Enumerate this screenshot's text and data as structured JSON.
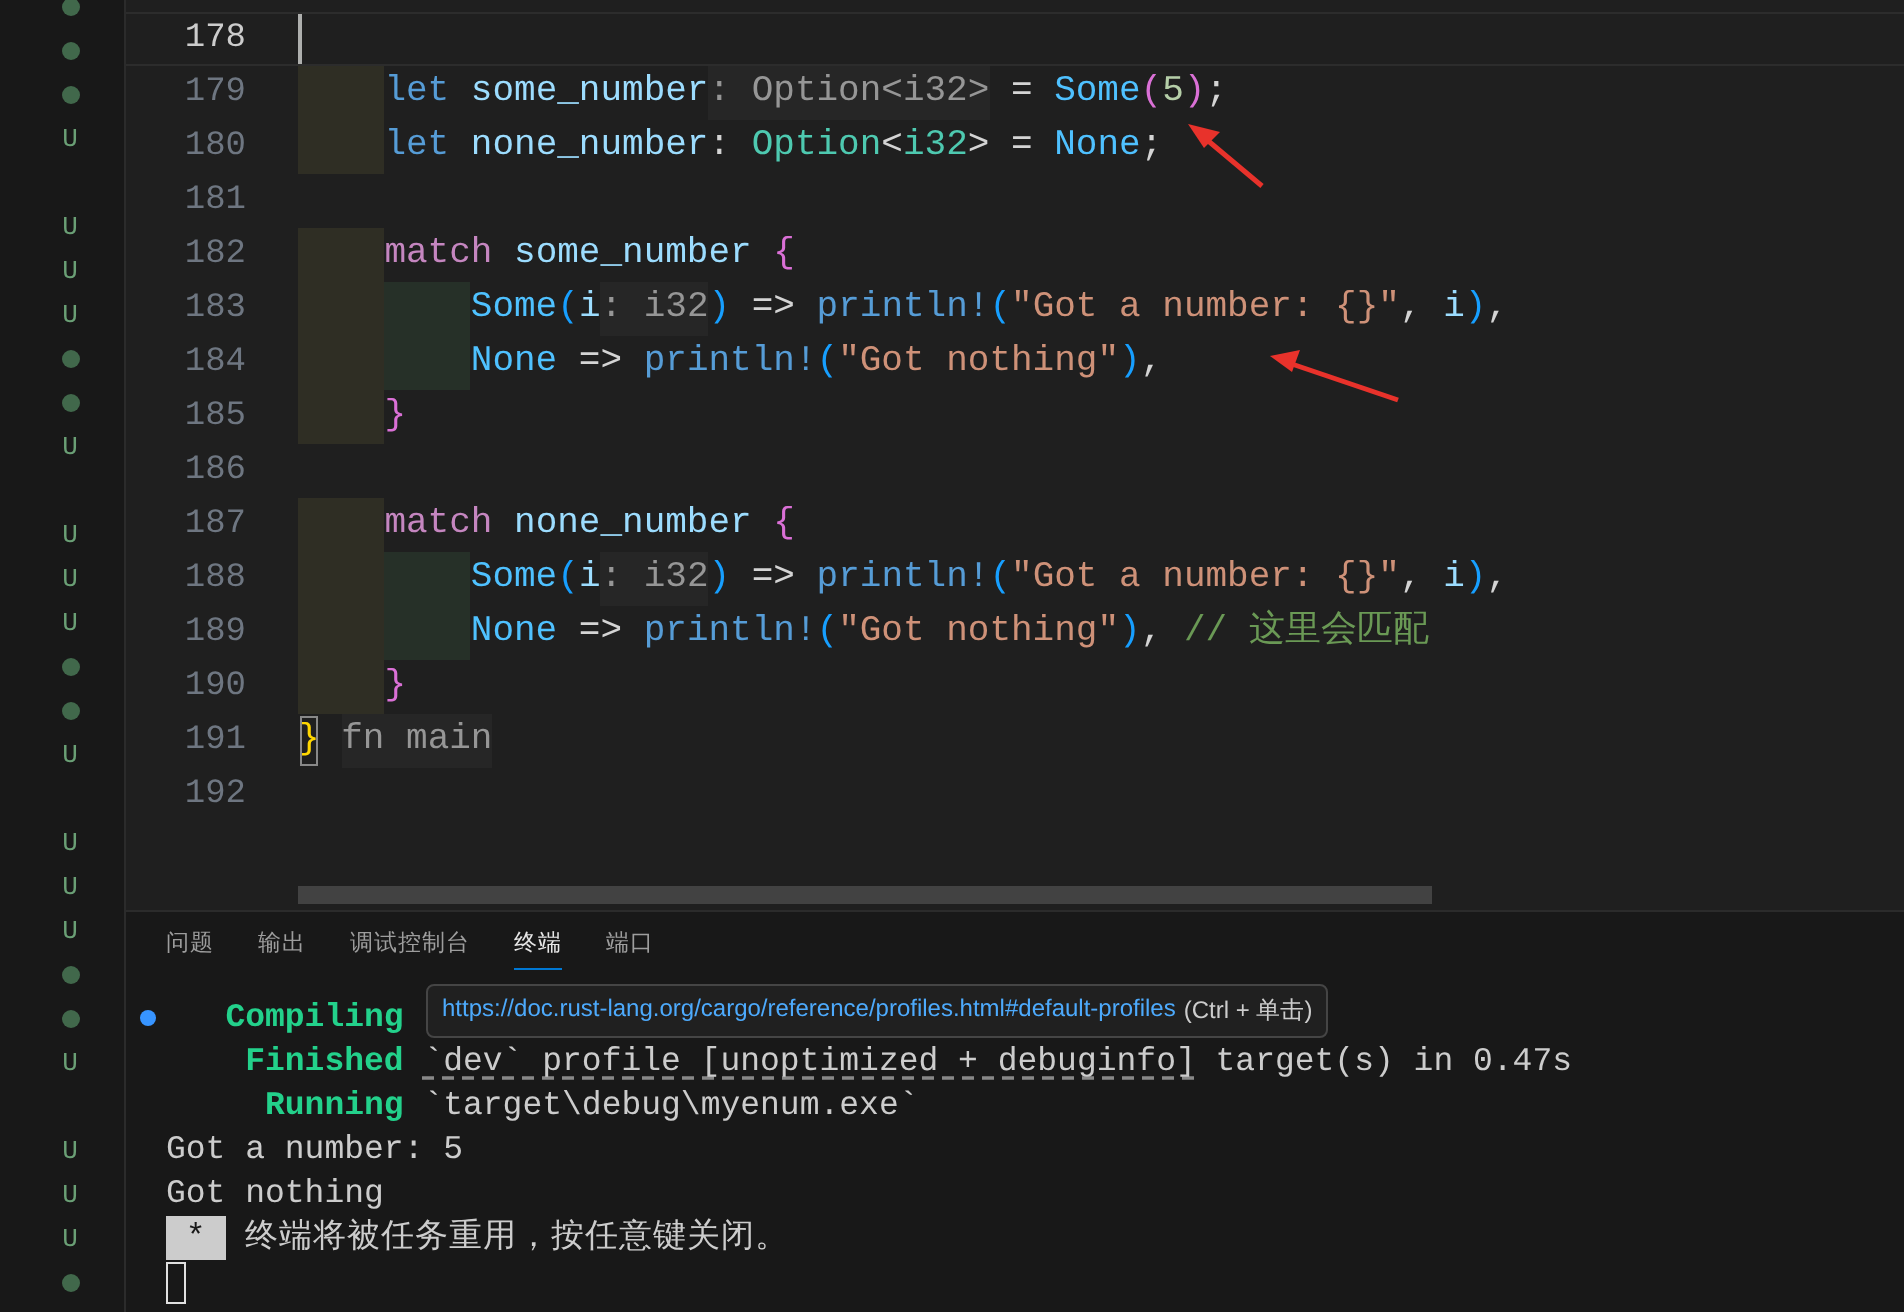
{
  "gutter_markers": [
    {
      "kind": "dot"
    },
    {
      "kind": "dot"
    },
    {
      "kind": "dot"
    },
    {
      "kind": "letter",
      "text": "U"
    },
    {
      "kind": "blank"
    },
    {
      "kind": "letter",
      "text": "U"
    },
    {
      "kind": "letter",
      "text": "U"
    },
    {
      "kind": "letter",
      "text": "U"
    },
    {
      "kind": "dot"
    },
    {
      "kind": "dot"
    },
    {
      "kind": "letter",
      "text": "U"
    },
    {
      "kind": "blank"
    },
    {
      "kind": "letter",
      "text": "U"
    },
    {
      "kind": "letter",
      "text": "U"
    },
    {
      "kind": "letter",
      "text": "U"
    },
    {
      "kind": "dot"
    },
    {
      "kind": "dot"
    },
    {
      "kind": "letter",
      "text": "U"
    },
    {
      "kind": "blank"
    },
    {
      "kind": "letter",
      "text": "U"
    },
    {
      "kind": "letter",
      "text": "U"
    },
    {
      "kind": "letter",
      "text": "U"
    },
    {
      "kind": "dot"
    },
    {
      "kind": "dot"
    },
    {
      "kind": "letter",
      "text": "U"
    },
    {
      "kind": "blank"
    },
    {
      "kind": "letter",
      "text": "U"
    },
    {
      "kind": "letter",
      "text": "U"
    },
    {
      "kind": "letter",
      "text": "U"
    },
    {
      "kind": "dot"
    }
  ],
  "editor": {
    "lines": [
      {
        "number": "178",
        "current": true
      },
      {
        "number": "179",
        "current": false,
        "tokens": [
          {
            "kind": "keyword",
            "text": "    let"
          },
          {
            "kind": "variable",
            "text": " some_number"
          },
          {
            "kind": "hint",
            "text": ": Option<i32>"
          },
          {
            "kind": "punct",
            "text": " = "
          },
          {
            "kind": "enum",
            "text": "Some"
          },
          {
            "kind": "bracket2",
            "text": "("
          },
          {
            "kind": "number",
            "text": "5"
          },
          {
            "kind": "bracket2",
            "text": ")"
          },
          {
            "kind": "punct",
            "text": ";"
          }
        ]
      },
      {
        "number": "180",
        "current": false,
        "tokens": [
          {
            "kind": "keyword",
            "text": "    let"
          },
          {
            "kind": "variable",
            "text": " none_number"
          },
          {
            "kind": "punct",
            "text": ": "
          },
          {
            "kind": "type",
            "text": "Option"
          },
          {
            "kind": "punct",
            "text": "<"
          },
          {
            "kind": "type",
            "text": "i32"
          },
          {
            "kind": "punct",
            "text": "> = "
          },
          {
            "kind": "enum",
            "text": "None"
          },
          {
            "kind": "punct",
            "text": ";"
          }
        ]
      },
      {
        "number": "181",
        "current": false
      },
      {
        "number": "182",
        "current": false,
        "tokens": [
          {
            "kind": "control",
            "text": "    match"
          },
          {
            "kind": "variable",
            "text": " some_number "
          },
          {
            "kind": "bracket2",
            "text": "{"
          }
        ]
      },
      {
        "number": "183",
        "current": false,
        "tokens": [
          {
            "kind": "enum",
            "text": "        Some"
          },
          {
            "kind": "bracket3",
            "text": "("
          },
          {
            "kind": "variable",
            "text": "i"
          },
          {
            "kind": "hint",
            "text": ": i32"
          },
          {
            "kind": "bracket3",
            "text": ")"
          },
          {
            "kind": "punct",
            "text": " => "
          },
          {
            "kind": "macro",
            "text": "println!"
          },
          {
            "kind": "bracket3",
            "text": "("
          },
          {
            "kind": "string",
            "text": "\"Got a number: {}\""
          },
          {
            "kind": "punct",
            "text": ", "
          },
          {
            "kind": "variable",
            "text": "i"
          },
          {
            "kind": "bracket3",
            "text": ")"
          },
          {
            "kind": "punct",
            "text": ","
          }
        ]
      },
      {
        "number": "184",
        "current": false,
        "tokens": [
          {
            "kind": "enum",
            "text": "        None"
          },
          {
            "kind": "punct",
            "text": " => "
          },
          {
            "kind": "macro",
            "text": "println!"
          },
          {
            "kind": "bracket3",
            "text": "("
          },
          {
            "kind": "string",
            "text": "\"Got nothing\""
          },
          {
            "kind": "bracket3",
            "text": ")"
          },
          {
            "kind": "punct",
            "text": ","
          }
        ]
      },
      {
        "number": "185",
        "current": false,
        "tokens": [
          {
            "kind": "bracket2",
            "text": "    }"
          }
        ]
      },
      {
        "number": "186",
        "current": false
      },
      {
        "number": "187",
        "current": false,
        "tokens": [
          {
            "kind": "control",
            "text": "    match"
          },
          {
            "kind": "variable",
            "text": " none_number "
          },
          {
            "kind": "bracket2",
            "text": "{"
          }
        ]
      },
      {
        "number": "188",
        "current": false,
        "tokens": [
          {
            "kind": "enum",
            "text": "        Some"
          },
          {
            "kind": "bracket3",
            "text": "("
          },
          {
            "kind": "variable",
            "text": "i"
          },
          {
            "kind": "hint",
            "text": ": i32"
          },
          {
            "kind": "bracket3",
            "text": ")"
          },
          {
            "kind": "punct",
            "text": " => "
          },
          {
            "kind": "macro",
            "text": "println!"
          },
          {
            "kind": "bracket3",
            "text": "("
          },
          {
            "kind": "string",
            "text": "\"Got a number: {}\""
          },
          {
            "kind": "punct",
            "text": ", "
          },
          {
            "kind": "variable",
            "text": "i"
          },
          {
            "kind": "bracket3",
            "text": ")"
          },
          {
            "kind": "punct",
            "text": ","
          }
        ]
      },
      {
        "number": "189",
        "current": false,
        "tokens": [
          {
            "kind": "enum",
            "text": "        None"
          },
          {
            "kind": "punct",
            "text": " => "
          },
          {
            "kind": "macro",
            "text": "println!"
          },
          {
            "kind": "bracket3",
            "text": "("
          },
          {
            "kind": "string",
            "text": "\"Got nothing\""
          },
          {
            "kind": "bracket3",
            "text": ")"
          },
          {
            "kind": "punct",
            "text": ", "
          },
          {
            "kind": "comment",
            "text": "// 这里会匹配"
          }
        ]
      },
      {
        "number": "190",
        "current": false,
        "tokens": [
          {
            "kind": "bracket2",
            "text": "    }"
          }
        ]
      },
      {
        "number": "191",
        "current": false,
        "tokens": [
          {
            "kind": "matched",
            "text": "}"
          },
          {
            "kind": "hint",
            "text": "fn main"
          }
        ]
      },
      {
        "number": "192",
        "current": false
      }
    ]
  },
  "panel": {
    "tabs": [
      {
        "label": "问题",
        "selected": false
      },
      {
        "label": "输出",
        "selected": false
      },
      {
        "label": "调试控制台",
        "selected": false
      },
      {
        "label": "终端",
        "selected": true
      },
      {
        "label": "端口",
        "selected": false
      }
    ],
    "terminal": [
      {
        "kind": "status",
        "marked": true,
        "label": "Compiling"
      },
      {
        "kind": "status",
        "marked": false,
        "label": "Finished",
        "link": "`dev` profile [unoptimized + debuginfo]",
        "text": " target(s) in 0.47s"
      },
      {
        "kind": "status",
        "marked": false,
        "label": "Running",
        "text": "`target\\debug\\myenum.exe`"
      },
      {
        "kind": "output",
        "marked": false,
        "text": "Got a number: 5"
      },
      {
        "kind": "output",
        "marked": false,
        "text": "Got nothing"
      },
      {
        "kind": "notice",
        "marked": false,
        "badge": "*",
        "text": "终端将被任务重用，按任意键关闭。"
      },
      {
        "kind": "cursor",
        "marked": false
      }
    ],
    "tooltip": {
      "url": "https://doc.rust-lang.org/cargo/reference/profiles.html#default-profiles",
      "hint": "(Ctrl + 单击)"
    }
  }
}
